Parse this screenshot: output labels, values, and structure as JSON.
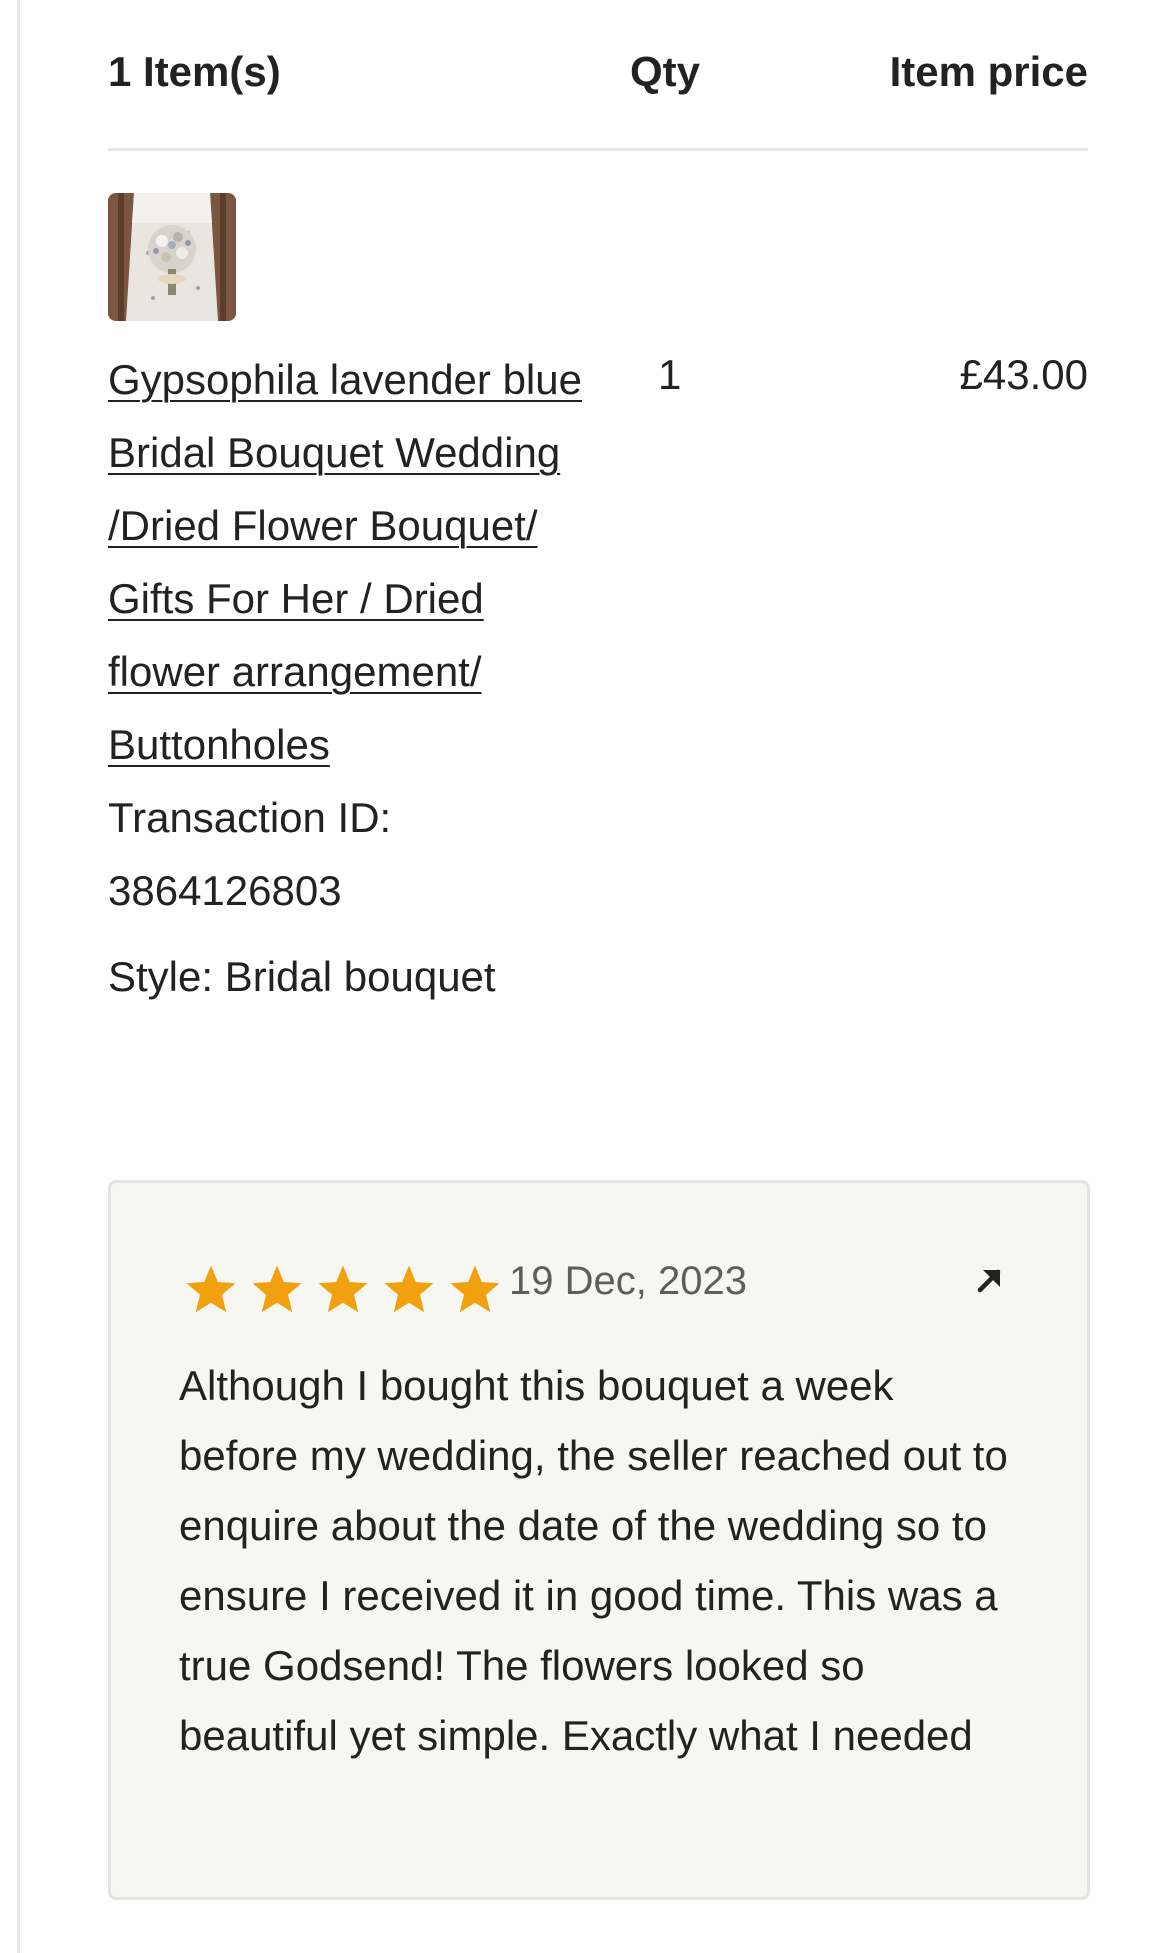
{
  "table": {
    "header_items": "1 Item(s)",
    "header_qty": "Qty",
    "header_price": "Item price"
  },
  "item": {
    "thumbnail": "bridal-bouquet-photo",
    "title": "Gypsophila lavender blue Bridal Bouquet Wedding /Dried Flower Bouquet/ Gifts For Her / Dried flower arrangement/ Buttonholes",
    "transaction": "Transaction ID: 3864126803",
    "style": "Style: Bridal bouquet",
    "qty": "1",
    "price": "£43.00"
  },
  "review": {
    "rating": 5,
    "rating_max": 5,
    "date": "19 Dec, 2023",
    "text": "Although I bought this bouquet a week before my wedding, the seller reached out to enquire about the date of the wedding so to ensure I received it in good time. This was a true Godsend! The flowers looked so beautiful yet simple. Exactly what I needed",
    "open_icon": "arrow-up-right-icon"
  },
  "colors": {
    "star": "#F1A10E",
    "card_background": "#F6F6F2",
    "divider": "#E5E5E5",
    "text": "#222222",
    "muted_text": "#5E5E5E"
  }
}
